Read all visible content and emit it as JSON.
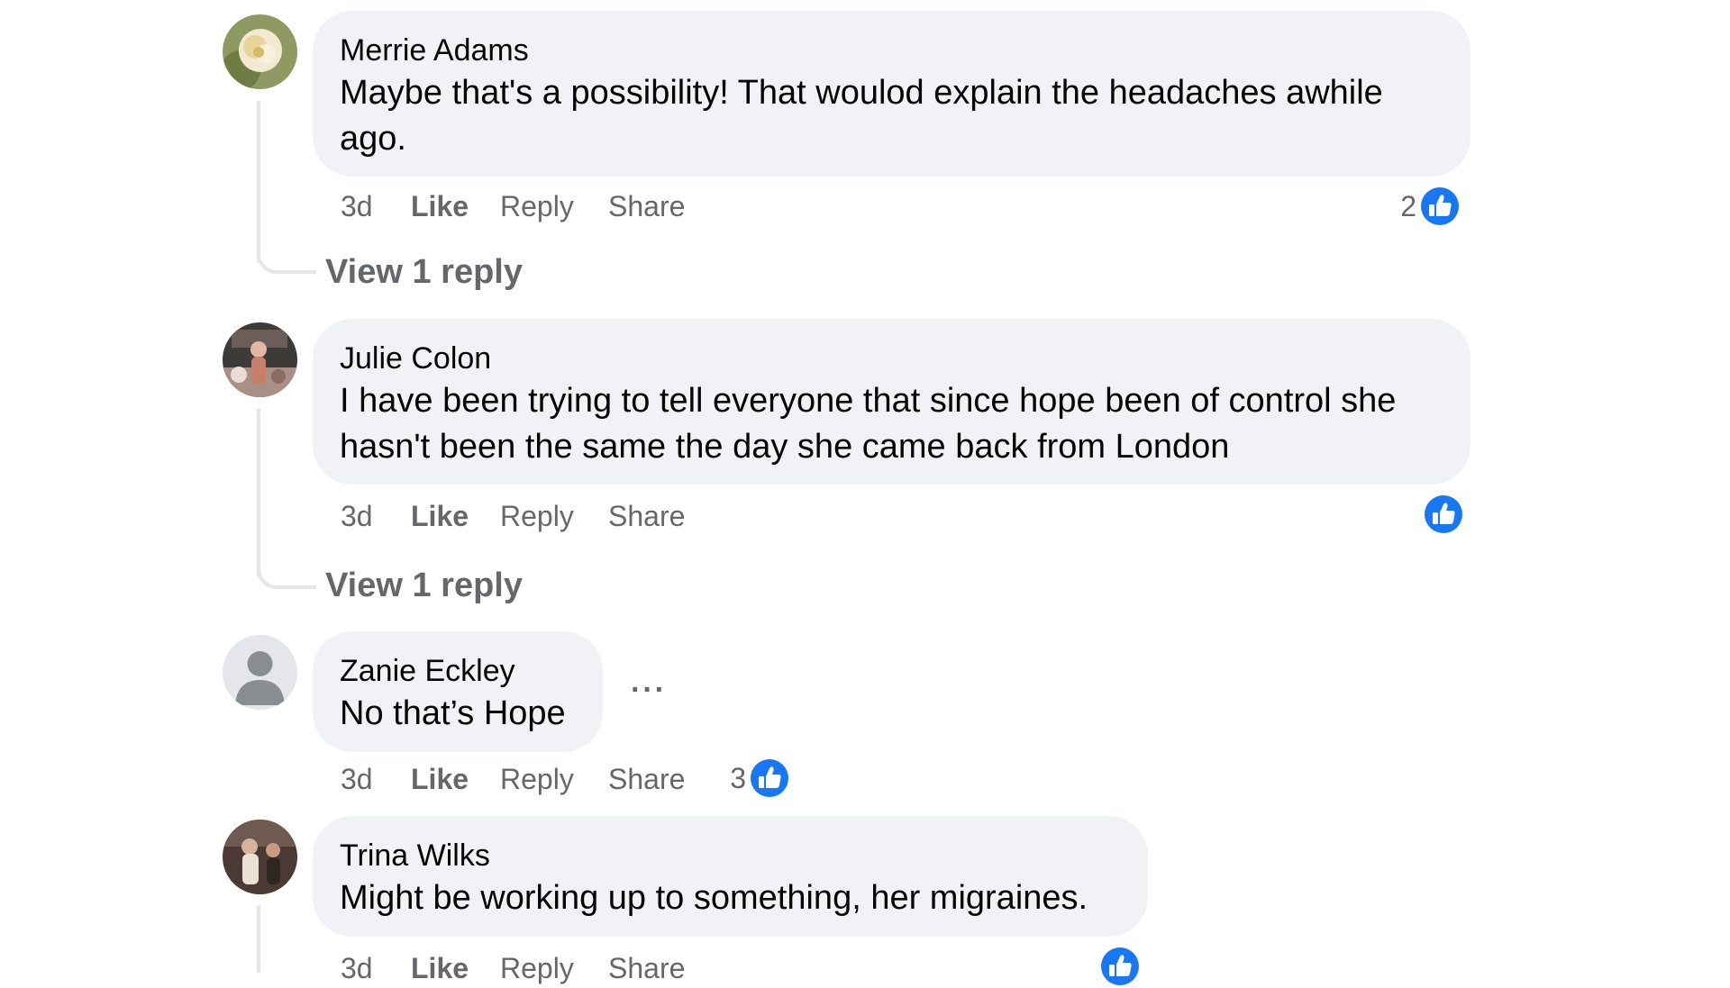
{
  "colors": {
    "bubble": "#f0f2f5",
    "secondary_text": "#65676b",
    "like_blue": "#1877f2",
    "thread_line": "#e4e6eb"
  },
  "comments": [
    {
      "author": "Merrie Adams",
      "text": "Maybe that's a possibility! That woulod explain the headaches awhile ago.",
      "time": "3d",
      "actions": {
        "like": "Like",
        "reply": "Reply",
        "share": "Share"
      },
      "reaction_count": "2",
      "reaction_icon": "like-icon",
      "view_replies": "View 1 reply"
    },
    {
      "author": "Julie Colon",
      "text": "I have been trying to tell everyone that since hope been of control she hasn't been the same the day she came back from London",
      "time": "3d",
      "actions": {
        "like": "Like",
        "reply": "Reply",
        "share": "Share"
      },
      "reaction_count": "",
      "reaction_icon": "like-icon",
      "view_replies": "View 1 reply"
    },
    {
      "author": "Zanie Eckley",
      "text": "No that’s Hope",
      "time": "3d",
      "actions": {
        "like": "Like",
        "reply": "Reply",
        "share": "Share"
      },
      "reaction_count": "3",
      "reaction_icon": "like-icon",
      "more_options": "···"
    },
    {
      "author": "Trina Wilks",
      "text": "Might be working up to something, her migraines.",
      "time": "3d",
      "actions": {
        "like": "Like",
        "reply": "Reply",
        "share": "Share"
      },
      "reaction_count": "",
      "reaction_icon": "like-icon"
    }
  ]
}
